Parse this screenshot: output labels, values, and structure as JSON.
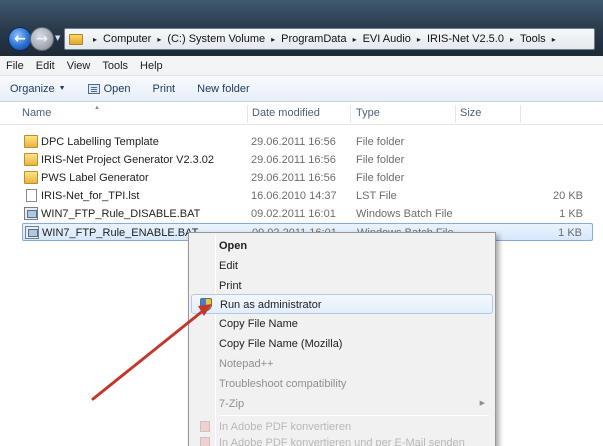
{
  "address_bar": {
    "crumbs": [
      "Computer",
      "(C:) System Volume",
      "ProgramData",
      "EVI Audio",
      "IRIS-Net V2.5.0",
      "Tools"
    ],
    "separator": "▸"
  },
  "menu_bar": {
    "items": [
      "File",
      "Edit",
      "View",
      "Tools",
      "Help"
    ]
  },
  "toolbar": {
    "organize": "Organize",
    "open": "Open",
    "print": "Print",
    "new_folder": "New folder"
  },
  "columns": {
    "name": "Name",
    "date": "Date modified",
    "type": "Type",
    "size": "Size"
  },
  "files": [
    {
      "name": "DPC Labelling Template",
      "date": "29.06.2011 16:56",
      "type": "File folder",
      "size": "",
      "icon": "folder-icon"
    },
    {
      "name": "IRIS-Net Project Generator V2.3.02",
      "date": "29.06.2011 16:56",
      "type": "File folder",
      "size": "",
      "icon": "folder-icon"
    },
    {
      "name": "PWS Label Generator",
      "date": "29.06.2011 16:56",
      "type": "File folder",
      "size": "",
      "icon": "folder-icon"
    },
    {
      "name": "IRIS-Net_for_TPI.lst",
      "date": "16.06.2010 14:37",
      "type": "LST File",
      "size": "20 KB",
      "icon": "document-icon"
    },
    {
      "name": "WIN7_FTP_Rule_DISABLE.BAT",
      "date": "09.02.2011 16:01",
      "type": "Windows Batch File",
      "size": "1 KB",
      "icon": "batch-file-icon"
    },
    {
      "name": "WIN7_FTP_Rule_ENABLE.BAT",
      "date": "09.02.2011 16:01",
      "type": "Windows Batch File",
      "size": "1 KB",
      "icon": "batch-file-icon",
      "selected": true
    }
  ],
  "context_menu": {
    "open": "Open",
    "edit": "Edit",
    "print": "Print",
    "run_as_admin": "Run as administrator",
    "copy_file_name": "Copy File Name",
    "copy_file_name_mozilla": "Copy File Name (Mozilla)",
    "notepad": "Notepad++",
    "troubleshoot": "Troubleshoot compatibility",
    "zip": "7-Zip",
    "pdf_convert": "In Adobe PDF konvertieren",
    "pdf_email": "In Adobe PDF konvertieren und per E-Mail senden"
  },
  "colors": {
    "annotation_arrow": "#c0392b",
    "selection_border": "#84acdd"
  }
}
